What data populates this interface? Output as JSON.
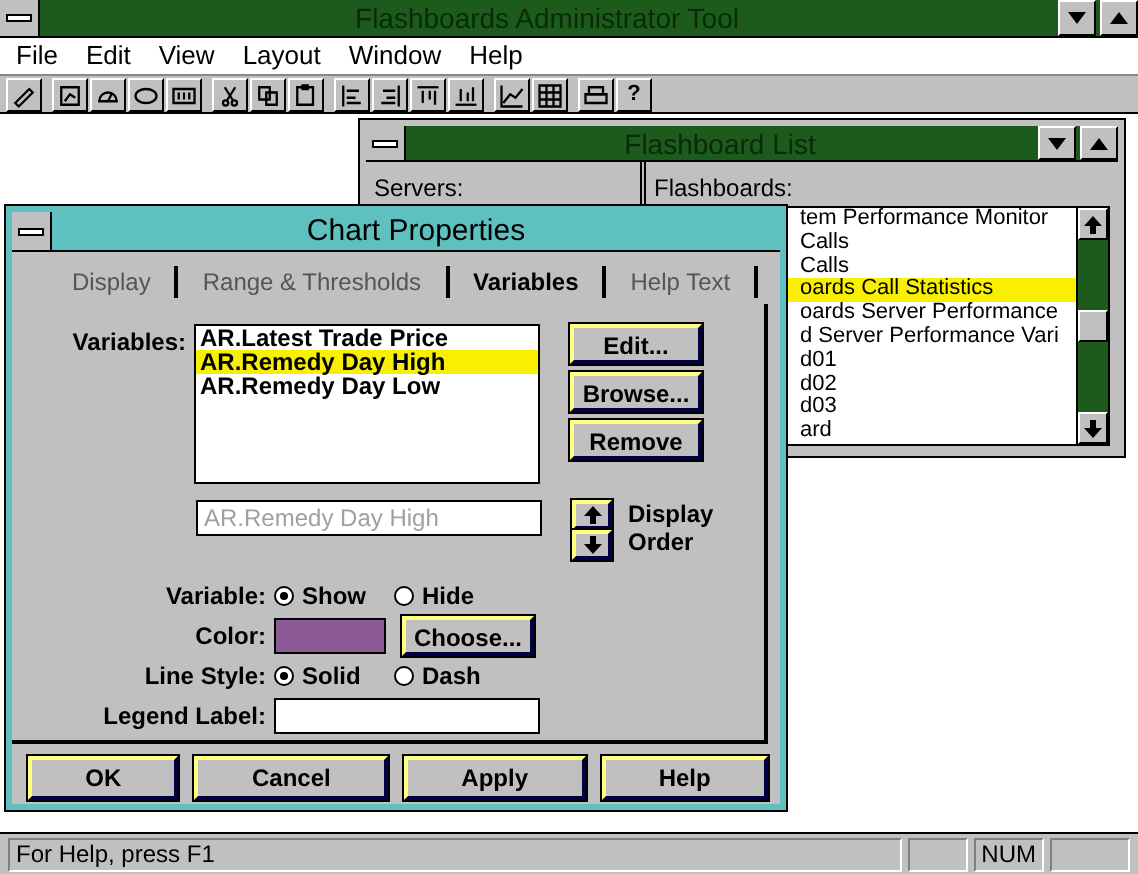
{
  "app": {
    "title": "Flashboards Administrator Tool"
  },
  "menu": [
    {
      "label": "File"
    },
    {
      "label": "Edit"
    },
    {
      "label": "View"
    },
    {
      "label": "Layout"
    },
    {
      "label": "Window"
    },
    {
      "label": "Help"
    }
  ],
  "toolbar": {
    "help_label": "?"
  },
  "flashboard_list": {
    "title": "Flashboard List",
    "servers_label": "Servers:",
    "flashboards_label": "Flashboards:",
    "flashboards": [
      {
        "label": "tem Performance Monitor",
        "selected": false
      },
      {
        "label": "Calls",
        "selected": false
      },
      {
        "label": "Calls",
        "selected": false
      },
      {
        "label": "oards Call Statistics",
        "selected": true
      },
      {
        "label": "oards Server Performance",
        "selected": false
      },
      {
        "label": "d Server Performance Vari",
        "selected": false
      },
      {
        "label": "d01",
        "selected": false
      },
      {
        "label": "d02",
        "selected": false
      },
      {
        "label": "d03",
        "selected": false
      },
      {
        "label": "ard",
        "selected": false
      }
    ]
  },
  "dialog": {
    "title": "Chart Properties",
    "tabs": [
      {
        "label": "Display",
        "selected": false
      },
      {
        "label": "Range & Thresholds",
        "selected": false
      },
      {
        "label": "Variables",
        "selected": true
      },
      {
        "label": "Help Text",
        "selected": false
      }
    ],
    "variables_label": "Variables:",
    "variables": [
      {
        "label": "AR.Latest Trade Price",
        "selected": false
      },
      {
        "label": "AR.Remedy Day High",
        "selected": true
      },
      {
        "label": "AR.Remedy Day Low",
        "selected": false
      }
    ],
    "side_buttons": [
      "Edit...",
      "Browse...",
      "Remove"
    ],
    "name_field": {
      "value": "AR.Remedy Day High",
      "disabled": true
    },
    "display_order_label": "Display Order",
    "variable": {
      "label": "Variable:",
      "options": [
        {
          "label": "Show",
          "selected": true
        },
        {
          "label": "Hide",
          "selected": false
        }
      ]
    },
    "color": {
      "label": "Color:",
      "color": "#8c5a96",
      "button": "Choose..."
    },
    "line_style": {
      "label": "Line Style:",
      "options": [
        {
          "label": "Solid",
          "selected": true
        },
        {
          "label": "Dash",
          "selected": false
        }
      ]
    },
    "legend_label": {
      "label": "Legend Label:"
    },
    "buttons": [
      "OK",
      "Cancel",
      "Apply",
      "Help"
    ]
  },
  "status_bar": {
    "text": "For Help, press F1",
    "indicator": "NUM"
  }
}
